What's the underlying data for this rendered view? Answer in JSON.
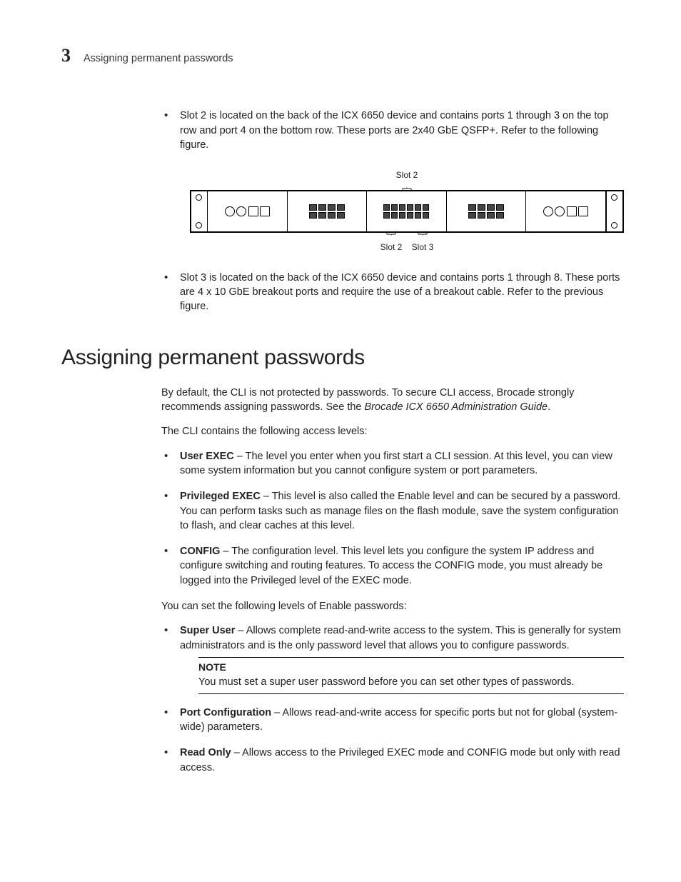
{
  "header": {
    "chapter_number": "3",
    "running_title": "Assigning permanent passwords"
  },
  "bullets_top": [
    "Slot 2 is located on the back of the ICX 6650 device and contains ports 1 through 3 on the top row and port 4 on the bottom row. These ports are 2x40 GbE QSFP+. Refer to the following figure.",
    "Slot 3 is located on the back of the ICX 6650 device and contains ports 1 through 8. These ports are 4 x 10 GbE breakout ports and require the use of a breakout cable. Refer to the previous figure."
  ],
  "figure": {
    "top_label": "Slot 2",
    "bottom_labels": [
      "Slot 2",
      "Slot 3"
    ]
  },
  "section_heading": "Assigning permanent passwords",
  "intro": {
    "p1_a": "By default, the CLI is not protected by passwords. To secure CLI access, Brocade strongly recommends assigning passwords. See the ",
    "p1_ref": "Brocade ICX 6650 Administration Guide",
    "p1_b": ".",
    "p2": "The CLI contains the following access levels:"
  },
  "access_levels": [
    {
      "name": "User EXEC",
      "desc": " – The level you enter when you first start a CLI session. At this level, you can view some system information but you cannot configure system or port parameters."
    },
    {
      "name": "Privileged EXEC",
      "desc": " – This level is also called the Enable level and can be secured by a password. You can perform tasks such as manage files on the flash module, save the system configuration to flash, and clear caches at this level."
    },
    {
      "name": "CONFIG",
      "desc": " – The configuration level. This level lets you configure the system IP address and configure switching and routing features. To access the CONFIG mode, you must already be logged into the Privileged level of the EXEC mode."
    }
  ],
  "enable_intro": "You can set the following levels of Enable passwords:",
  "enable_levels": {
    "super_user": {
      "name": "Super User",
      "desc": " – Allows complete read-and-write access to the system. This is generally for system administrators and is the only password level that allows you to configure passwords."
    },
    "port_config": {
      "name": "Port Configuration",
      "desc": " – Allows read-and-write access for specific ports but not for global (system-wide) parameters."
    },
    "read_only": {
      "name": "Read Only",
      "desc": " – Allows access to the Privileged EXEC mode and CONFIG mode but only with read access."
    }
  },
  "note": {
    "title": "NOTE",
    "text": "You must set a super user password before you can set other types of passwords."
  }
}
